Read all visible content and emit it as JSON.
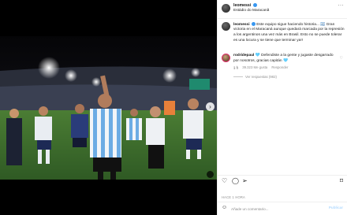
{
  "post": {
    "username": "leomessi",
    "location": "Estádio do Maracanã",
    "more_label": "···"
  },
  "caption": {
    "username": "leomessi",
    "text": "Este equipo sigue haciendo historia... 🇦🇷 Gran victoria en el Maracaná aunque quedará marcada por la represión a los argentinos una vez más en Brasil. Esto no se puede tolerar es una locura y se tiene que terminar ya!!",
    "time": "1 h"
  },
  "comment": {
    "username": "rodridepaul",
    "heart": "🩵",
    "text": "Defendiste a la gente y jugaste desgarrado por nosotros, gracias capitán",
    "time": "1 h",
    "likes": "39.323 Me gusta",
    "reply_label": "Responder",
    "replies_label": "Ver respuestas (982)"
  },
  "actions": {
    "like_icon": "heart-outline-icon",
    "comment_icon": "comment-bubble-icon",
    "share_icon": "paper-plane-icon",
    "save_icon": "bookmark-icon",
    "date": "HACE 1 HORA"
  },
  "composer": {
    "placeholder": "Añade un comentario...",
    "post_label": "Publicar"
  },
  "colors": {
    "accent": "#3897f0",
    "muted": "#8e8e8e",
    "pitch": "#3d6b2e",
    "shirt_stripe": "#6cace4"
  }
}
